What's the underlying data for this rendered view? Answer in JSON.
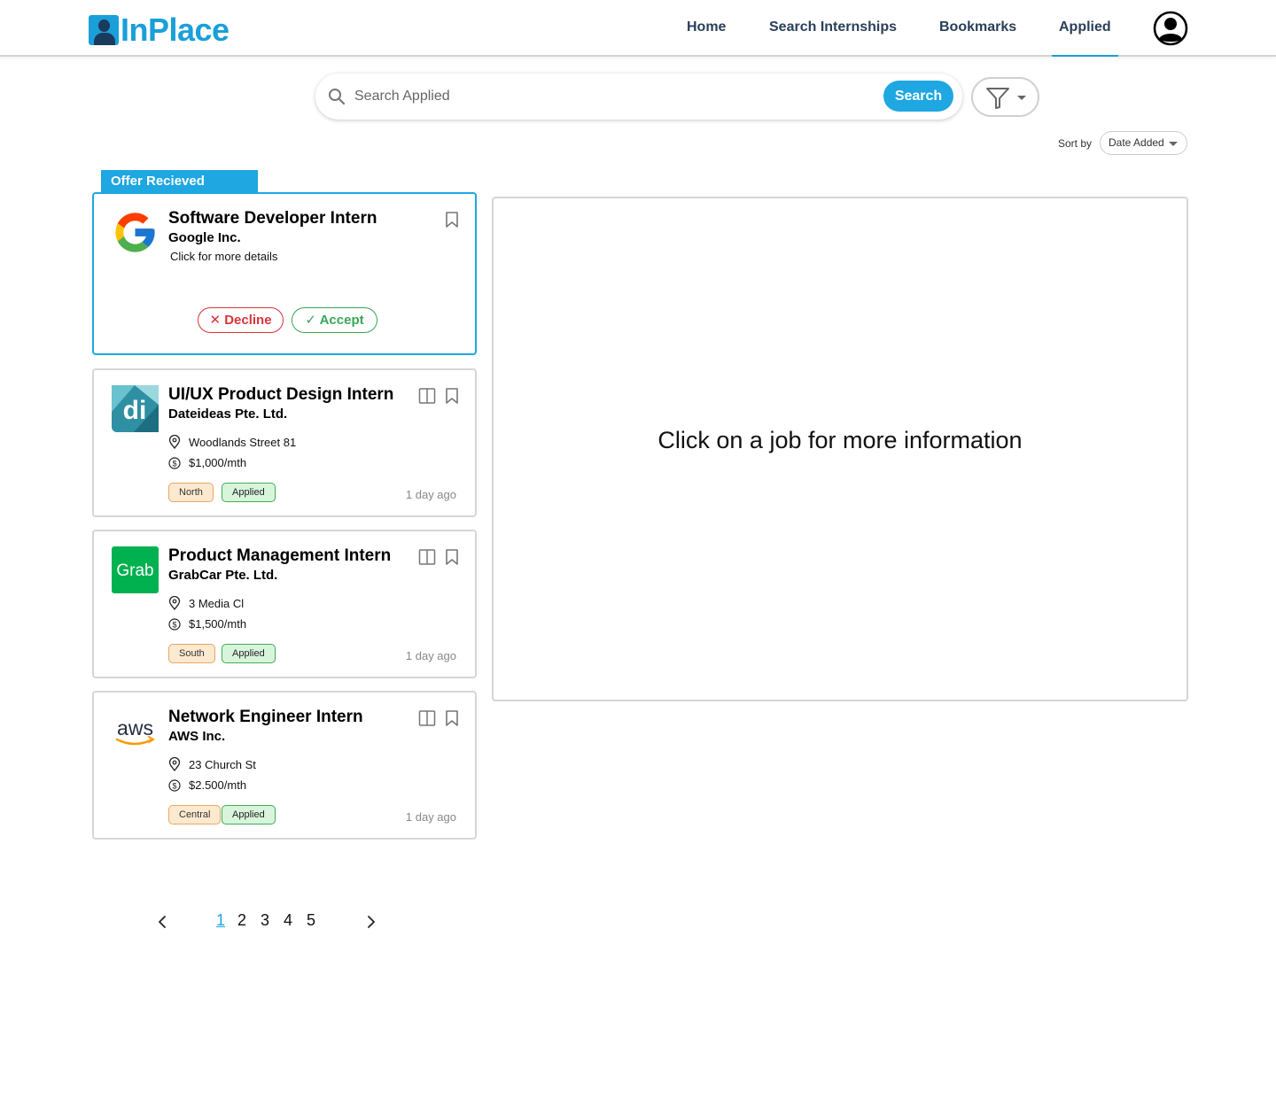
{
  "app": {
    "logo_text": "InPlace"
  },
  "nav": {
    "items": [
      {
        "label": "Home"
      },
      {
        "label": "Search Internships"
      },
      {
        "label": "Bookmarks"
      },
      {
        "label": "Applied",
        "active": true
      }
    ]
  },
  "search": {
    "placeholder": "Search Applied",
    "value": "",
    "button_label": "Search"
  },
  "sort": {
    "label": "Sort by",
    "selected": "Date Added"
  },
  "offer_section": {
    "tab_label": "Offer Recieved",
    "card": {
      "title": "Software Developer Intern",
      "company": "Google Inc.",
      "details_text": "Click for more details",
      "decline_label": "Decline",
      "accept_label": "Accept"
    }
  },
  "jobs": [
    {
      "title": "UI/UX Product Design Intern",
      "company": "Dateideas Pte. Ltd.",
      "location": "Woodlands Street 81",
      "salary": "$1,000/mth",
      "region": "North",
      "status": "Applied",
      "posted": "1 day ago",
      "logo_text": "di"
    },
    {
      "title": "Product Management Intern",
      "company": "GrabCar Pte. Ltd.",
      "location": "3 Media Cl",
      "salary": "$1,500/mth",
      "region": "South",
      "status": "Applied",
      "posted": "1 day ago",
      "logo_text": "Grab"
    },
    {
      "title": "Network Engineer Intern",
      "company": "AWS Inc.",
      "location": "23 Church St",
      "salary": "$2.500/mth",
      "region": "Central",
      "status": "Applied",
      "posted": "1 day ago",
      "logo_text": "aws"
    }
  ],
  "detail_panel": {
    "message": "Click on a job for more information"
  },
  "pagination": {
    "pages": [
      "1",
      "2",
      "3",
      "4",
      "5"
    ],
    "current": "1"
  },
  "colors": {
    "accent": "#1ea7e1",
    "nav_text": "#2a3f5a",
    "decline": "#d9343a",
    "accept": "#3aa656"
  }
}
